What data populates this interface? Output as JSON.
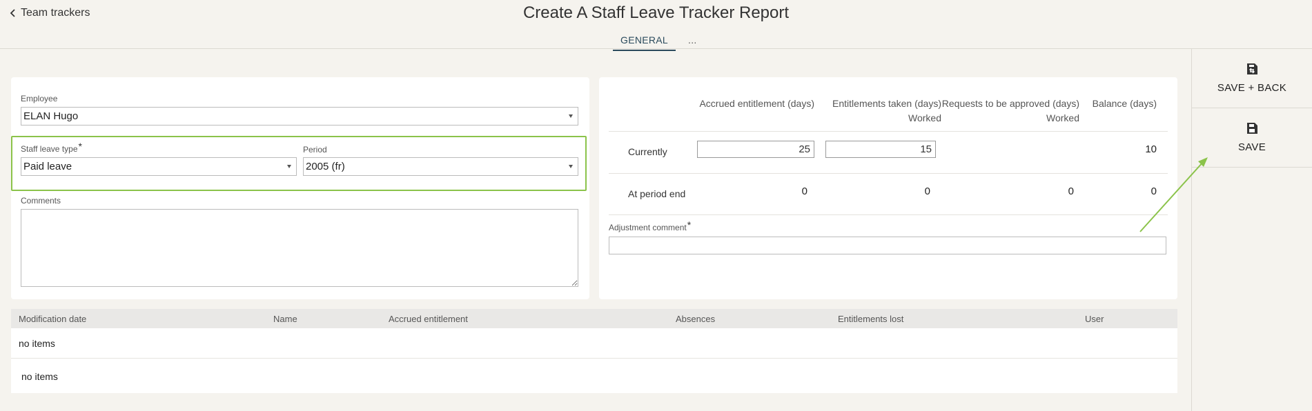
{
  "header": {
    "back_label": "Team trackers",
    "title": "Create A Staff Leave Tracker Report",
    "tabs": [
      {
        "label": "GENERAL",
        "active": true
      },
      {
        "label": "..."
      }
    ]
  },
  "actions": {
    "save_back": {
      "label": "SAVE + BACK",
      "icon": "save-back-icon"
    },
    "save": {
      "label": "SAVE",
      "icon": "save-icon"
    }
  },
  "form": {
    "employee": {
      "label": "Employee",
      "value": "ELAN Hugo"
    },
    "staff_leave_type": {
      "label": "Staff leave type",
      "required": "*",
      "value": "Paid leave"
    },
    "period": {
      "label": "Period",
      "value": "2005 (fr)"
    },
    "comments": {
      "label": "Comments",
      "value": ""
    }
  },
  "entitlements": {
    "columns": [
      {
        "line1": "Accrued entitlement (days)",
        "line2": ""
      },
      {
        "line1": "Entitlements taken (days)",
        "line2": "Worked"
      },
      {
        "line1": "Requests to be approved (days)",
        "line2": "Worked"
      },
      {
        "line1": "Balance (days)",
        "line2": ""
      }
    ],
    "rows": [
      {
        "label": "Currently",
        "values": [
          "25",
          "15",
          "",
          "10"
        ]
      },
      {
        "label": "At period end",
        "values": [
          "0",
          "0",
          "0",
          "0"
        ]
      }
    ],
    "adjustment_comment": {
      "label": "Adjustment comment",
      "required": "*",
      "value": ""
    }
  },
  "history_table": {
    "columns": [
      "Modification date",
      "Name",
      "Accrued entitlement",
      "Absences",
      "Entitlements lost",
      "User"
    ],
    "empty_rows": [
      "no items",
      "no items"
    ]
  },
  "colors": {
    "background": "#f5f3ee",
    "highlight": "#8bc34a",
    "tab_accent": "#2a4a5c"
  }
}
